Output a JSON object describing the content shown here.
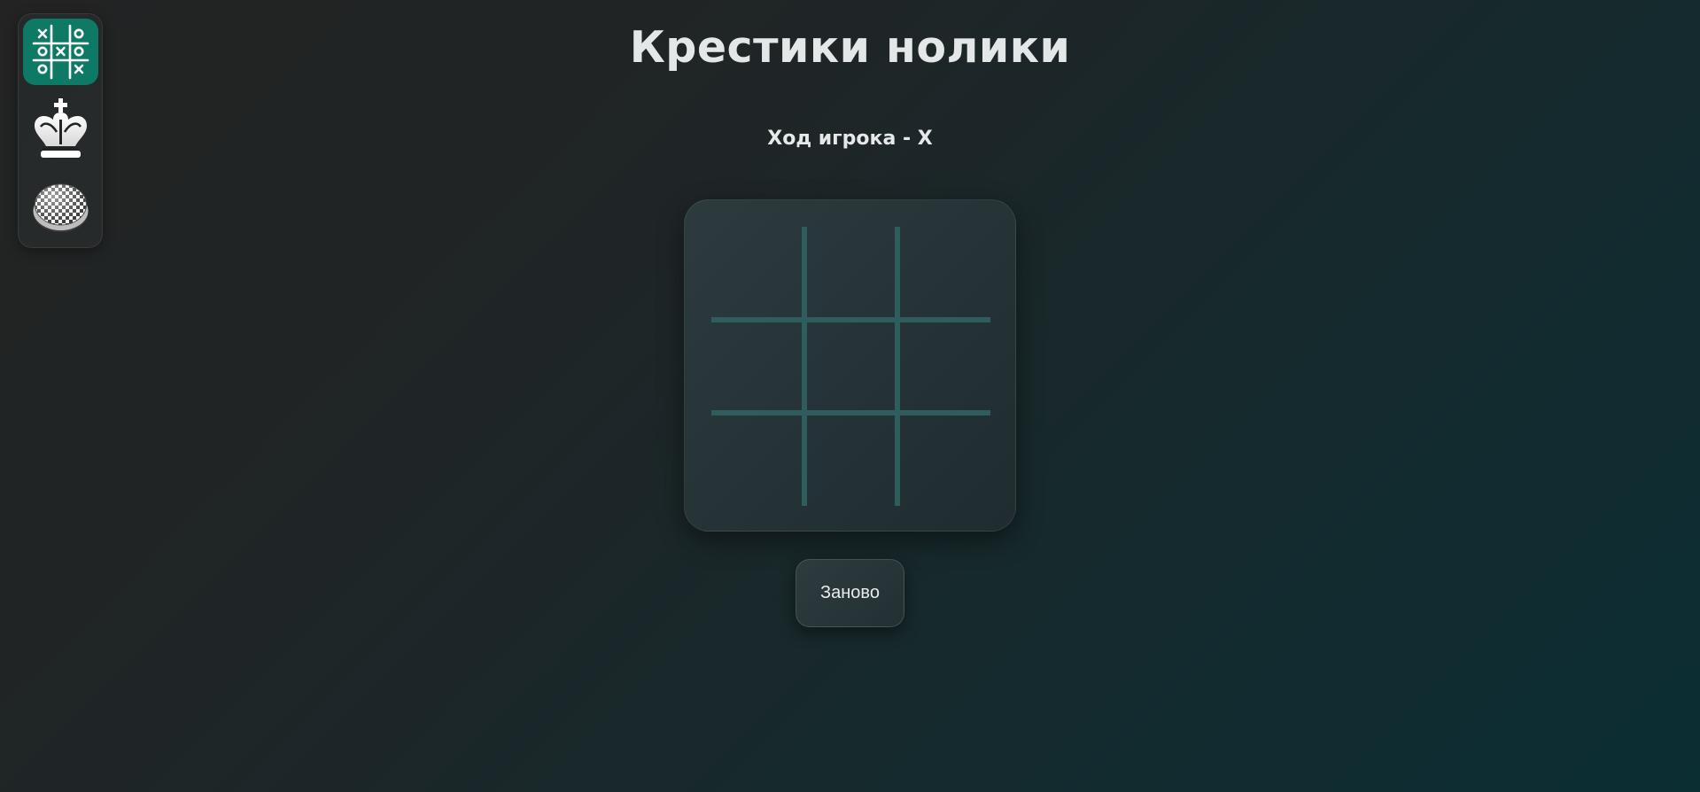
{
  "sidebar": {
    "items": [
      {
        "id": "tic-tac-toe",
        "icon": "tic-tac-toe-icon",
        "active": true,
        "color": "#0e7a66"
      },
      {
        "id": "chess",
        "icon": "chess-king-icon",
        "active": false
      },
      {
        "id": "checkers",
        "icon": "checkers-piece-icon",
        "active": false
      }
    ]
  },
  "header": {
    "title": "Крестики нолики"
  },
  "game": {
    "status": "Ход игрока - X",
    "current_player": "X",
    "board": [
      "",
      "",
      "",
      "",
      "",
      "",
      "",
      "",
      ""
    ],
    "grid_color": "#2f5d5d"
  },
  "controls": {
    "restart_label": "Заново"
  },
  "colors": {
    "accent": "#0e7a66",
    "background_start": "#232323",
    "background_end": "#0b2e33"
  }
}
